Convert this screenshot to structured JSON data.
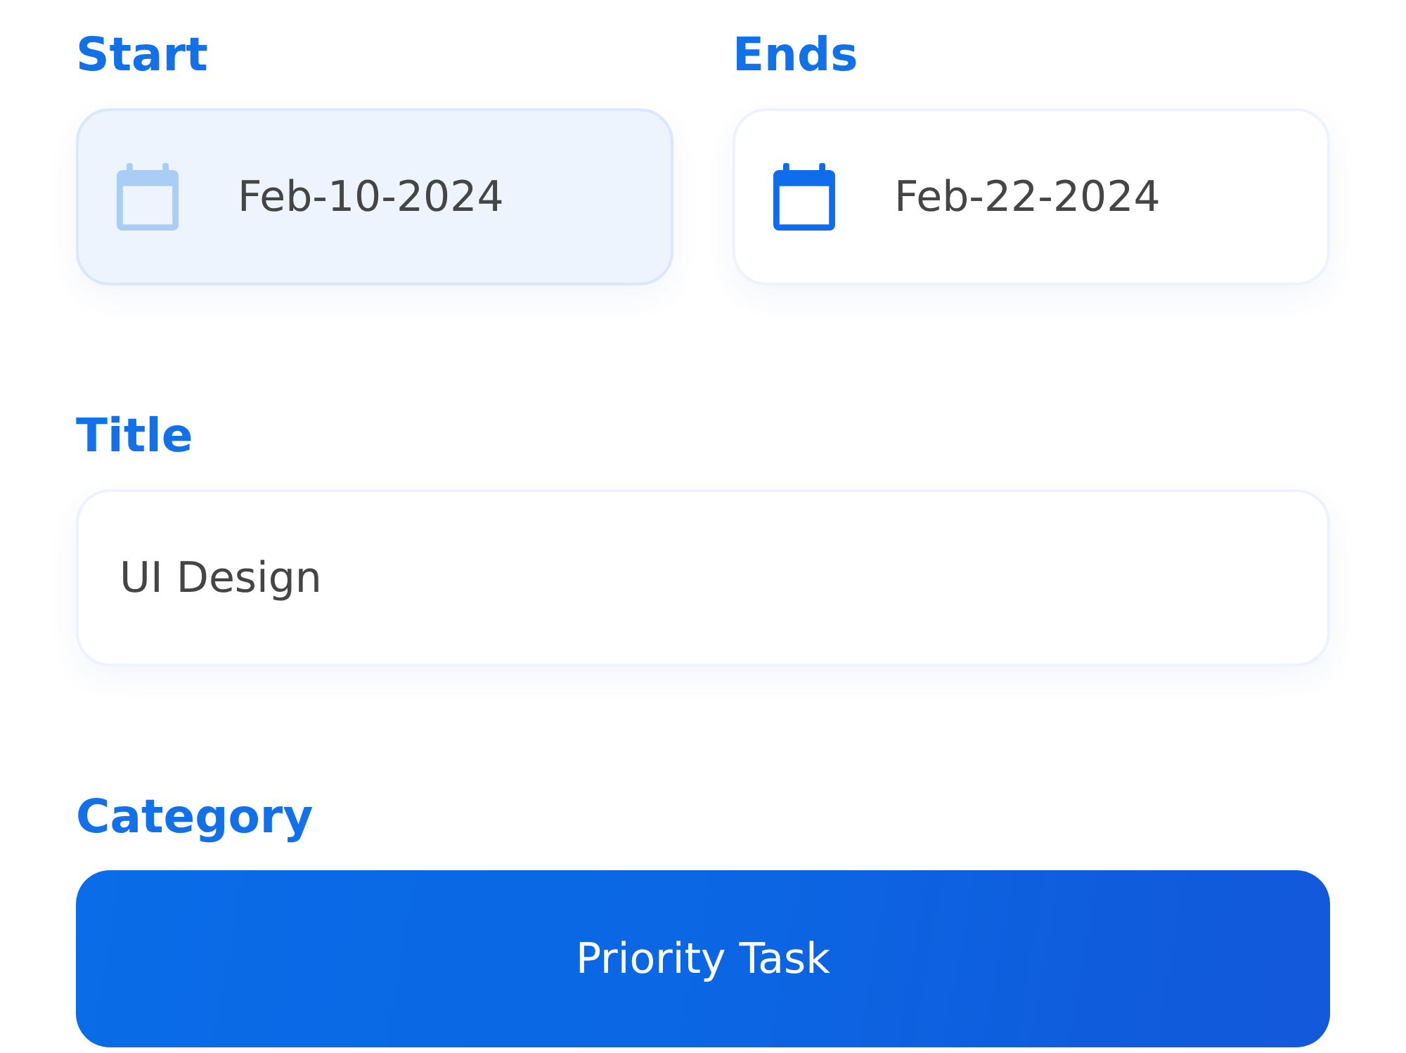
{
  "dates": [
    {
      "label": "Start",
      "value": "Feb-10-2024",
      "selected": true
    },
    {
      "label": "Ends",
      "value": "Feb-22-2024",
      "selected": false
    }
  ],
  "title": {
    "label": "Title",
    "value": "UI Design"
  },
  "category": {
    "label": "Category",
    "button": "Priority Task"
  }
}
